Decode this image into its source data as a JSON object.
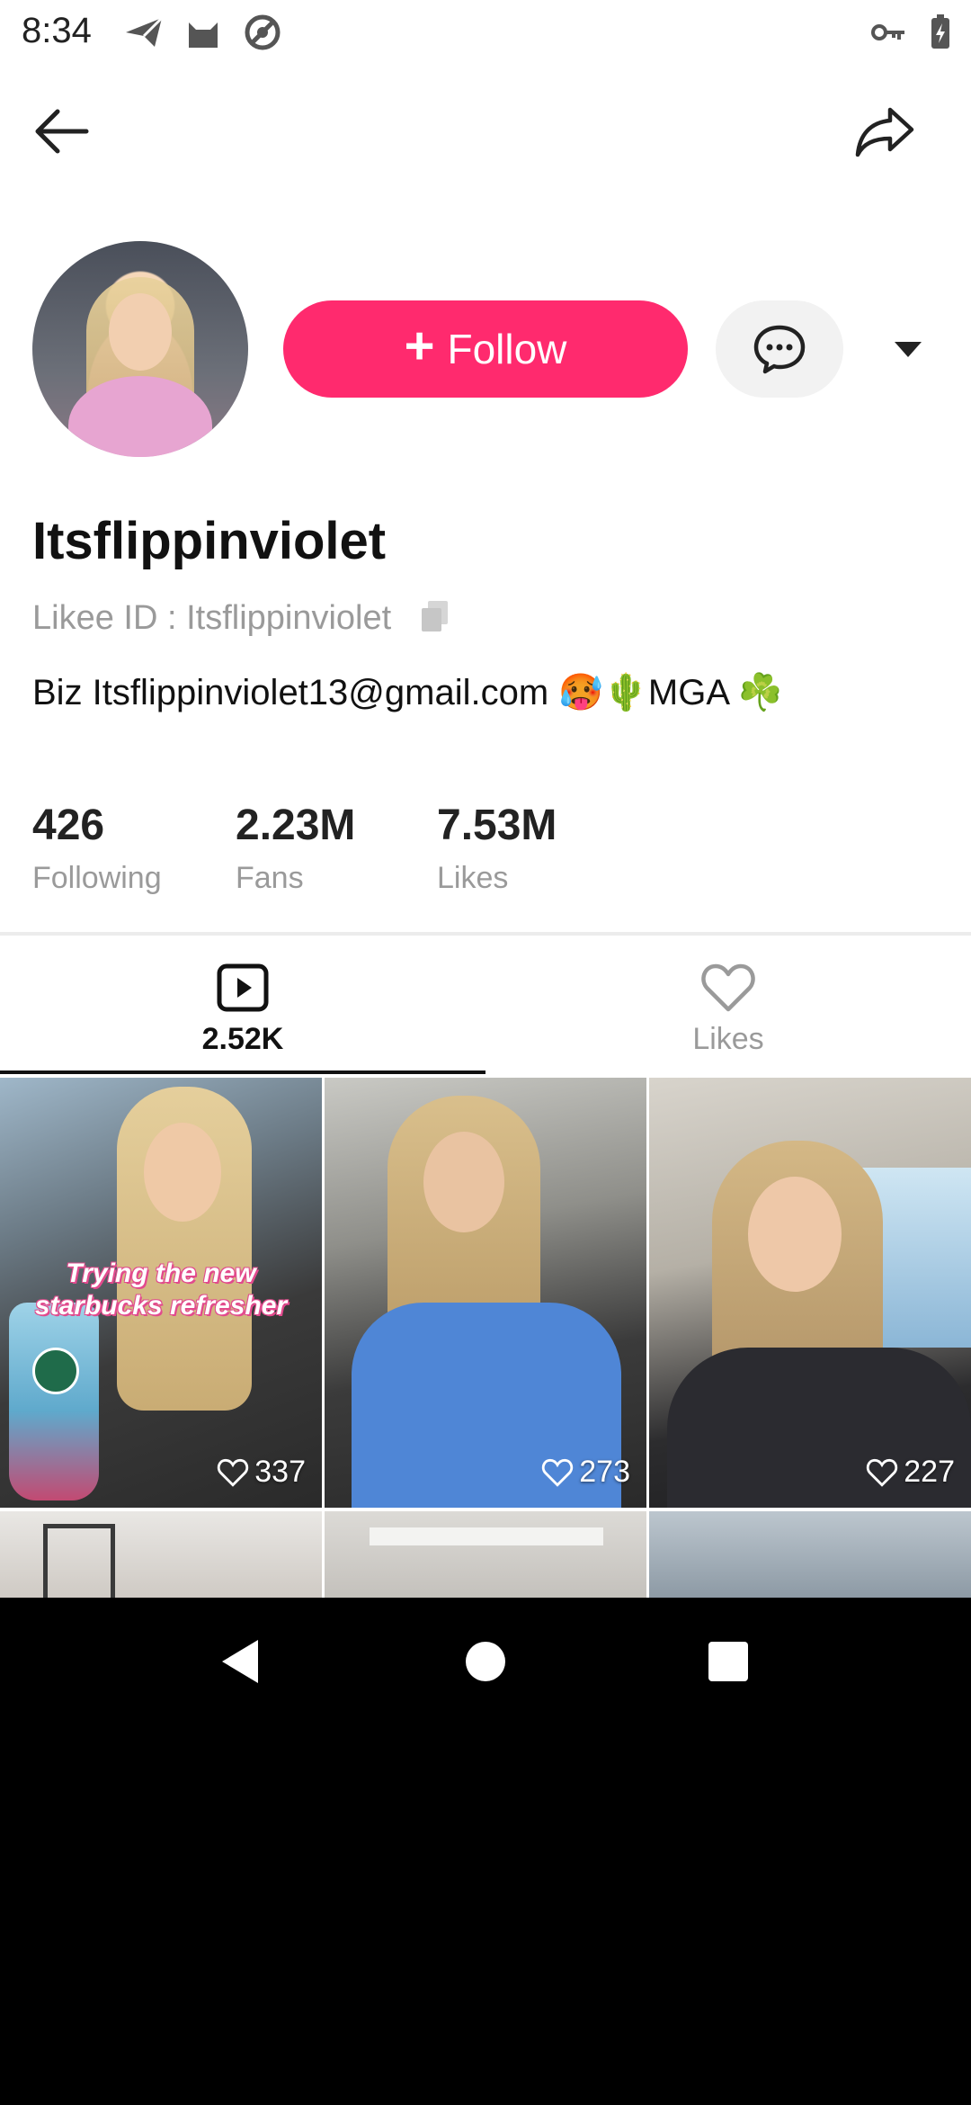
{
  "status_bar": {
    "time": "8:34",
    "icons": [
      "send-icon",
      "cat-icon",
      "at-sign-icon",
      "key-icon",
      "battery-charging-icon"
    ]
  },
  "header": {
    "back_icon": "arrow-left-icon",
    "share_icon": "share-arrow-icon"
  },
  "profile": {
    "follow_label": "Follow",
    "username": "Itsflippinviolet",
    "likee_id": "Likee ID : Itsflippinviolet",
    "bio": "Biz Itsflippinviolet13@gmail.com 🥵🌵MGA ☘️",
    "stats": [
      {
        "value": "426",
        "label": "Following"
      },
      {
        "value": "2.23M",
        "label": "Fans"
      },
      {
        "value": "7.53M",
        "label": "Likes"
      }
    ]
  },
  "tabs": [
    {
      "label": "2.52K",
      "icon": "video-play-icon",
      "active": true
    },
    {
      "label": "Likes",
      "icon": "heart-outline-icon",
      "active": false
    }
  ],
  "videos": [
    {
      "likes": "337",
      "caption": "Trying the new starbucks refresher"
    },
    {
      "likes": "273",
      "caption": ""
    },
    {
      "likes": "227",
      "caption": ""
    }
  ],
  "colors": {
    "accent": "#ff2a6e",
    "text_primary": "#111111",
    "text_secondary": "#9a9a9a"
  }
}
